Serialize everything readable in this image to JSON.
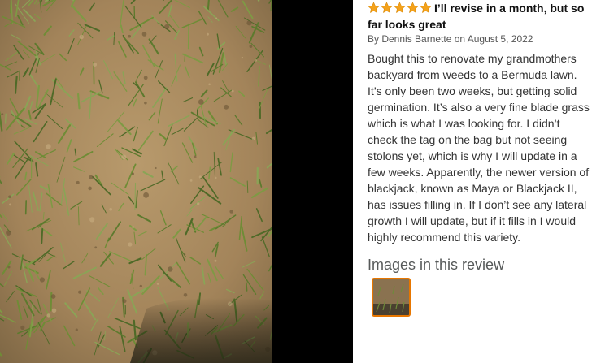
{
  "photo": {
    "alt": ""
  },
  "review": {
    "rating": 5,
    "rating_max": 5,
    "star_color": "#f4a21b",
    "headline_lines": [
      "I’ll revise in a month, but so",
      "far looks great"
    ],
    "byline": "By Dennis Barnette on August 5, 2022",
    "body_lines": [
      "Bought this to renovate my grandmothers",
      "backyard from weeds to a Bermuda lawn.",
      "It’s only been two weeks, but getting solid",
      "germination. It’s also a very fine blade grass",
      "which is what I was looking for. I didn’t",
      "check the tag on the bag but not seeing",
      "stolons yet, which is why I will update in a",
      "few weeks. Apparently, the newer version of",
      "blackjack, known as Maya or Blackjack II,",
      "has issues filling in. If I don’t see any lateral",
      "growth I will update, but if it fills in I would",
      "highly recommend this variety."
    ],
    "images_heading": "Images in this review",
    "thumbnail_border_color": "#e77600"
  }
}
